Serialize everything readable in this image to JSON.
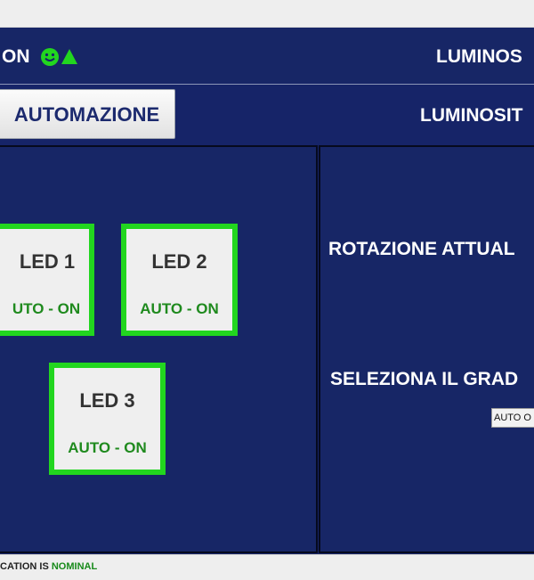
{
  "status": {
    "text_fragment": "ON",
    "icons": [
      "smiley-icon",
      "triangle-up-icon"
    ],
    "color": "#22d61f"
  },
  "header": {
    "luminosity_label_1": "LUMINOS",
    "luminosity_label_2": "LUMINOSIT"
  },
  "toolbar": {
    "automation_button": "AUTOMAZIONE"
  },
  "leds": [
    {
      "name": "LED 1",
      "state": "UTO - ON"
    },
    {
      "name": "LED 2",
      "state": "AUTO - ON"
    },
    {
      "name": "LED 3",
      "state": "AUTO - ON"
    }
  ],
  "rotation": {
    "label": "ROTAZIONE ATTUAL"
  },
  "selection": {
    "label": "SELEZIONA IL GRAD",
    "dropdown_value": "AUTO O"
  },
  "footer": {
    "prefix": "CATION IS ",
    "status": "NOMINAL"
  },
  "colors": {
    "background": "#172666",
    "led_border": "#22d61f",
    "led_state_text": "#1f8a1e"
  }
}
